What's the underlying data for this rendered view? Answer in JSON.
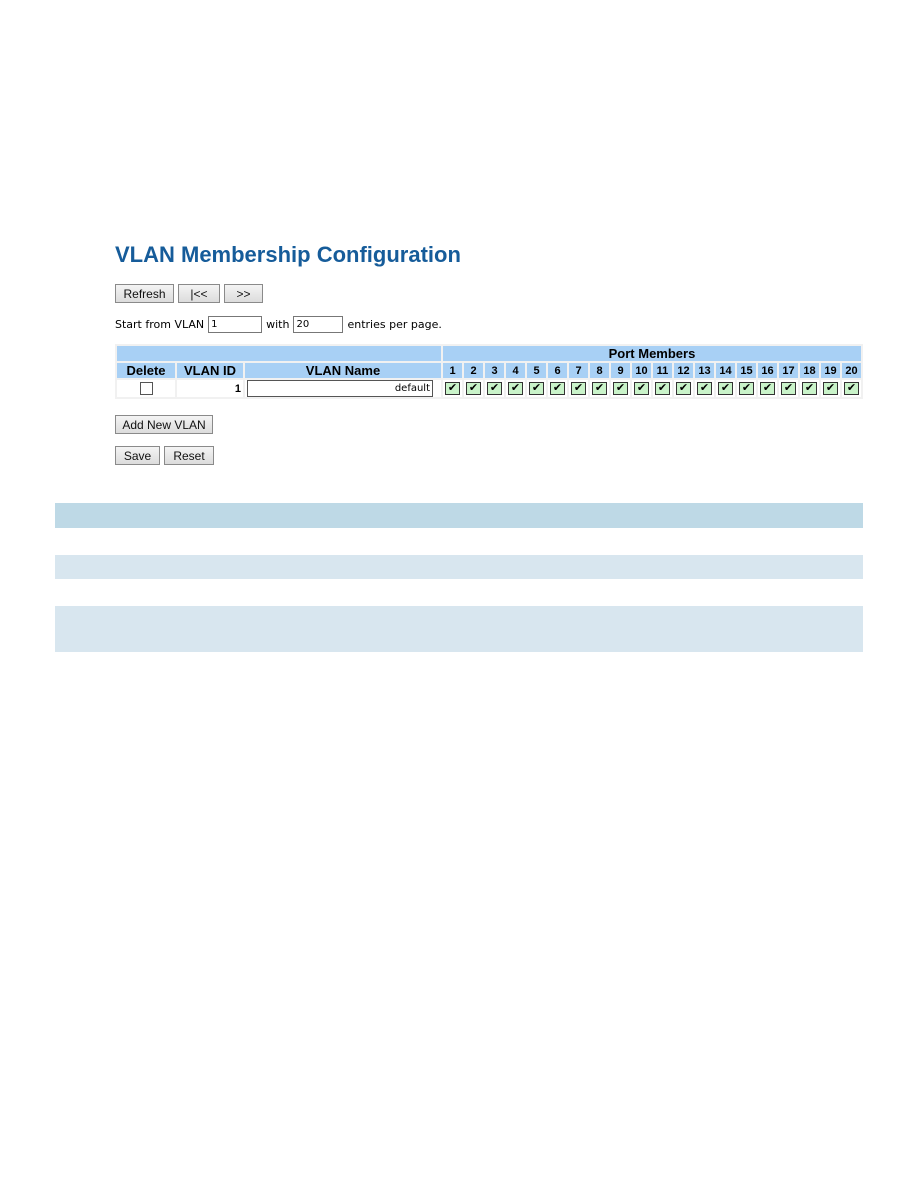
{
  "page": {
    "title": "VLAN Membership Configuration"
  },
  "toolbar": {
    "refresh_label": "Refresh",
    "first_label": "|<<",
    "next_label": ">>"
  },
  "paging": {
    "start_label": "Start from VLAN",
    "start_value": "1",
    "with_label": "with",
    "entries_value": "20",
    "entries_suffix": "entries per page."
  },
  "table": {
    "headers": {
      "delete": "Delete",
      "vlan_id": "VLAN ID",
      "vlan_name": "VLAN Name",
      "port_members": "Port Members"
    },
    "ports": [
      "1",
      "2",
      "3",
      "4",
      "5",
      "6",
      "7",
      "8",
      "9",
      "10",
      "11",
      "12",
      "13",
      "14",
      "15",
      "16",
      "17",
      "18",
      "19",
      "20"
    ],
    "rows": [
      {
        "delete": false,
        "vlan_id": "1",
        "vlan_name": "default",
        "members": [
          true,
          true,
          true,
          true,
          true,
          true,
          true,
          true,
          true,
          true,
          true,
          true,
          true,
          true,
          true,
          true,
          true,
          true,
          true,
          true
        ]
      }
    ]
  },
  "actions": {
    "add_label": "Add New VLAN",
    "save_label": "Save",
    "reset_label": "Reset"
  },
  "colors": {
    "title": "#165c9a",
    "header_bg": "#a8d0f5",
    "member_checked_bg": "#c9f3c9",
    "band_dark": "#bed9e6",
    "band_light": "#d8e6ef"
  }
}
